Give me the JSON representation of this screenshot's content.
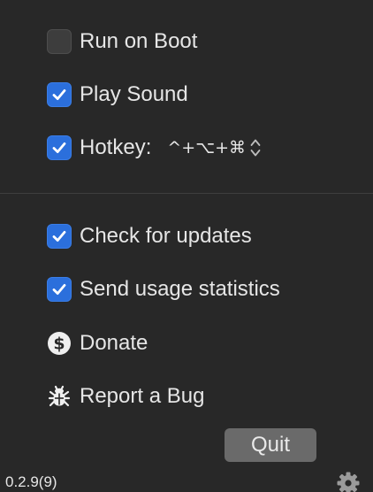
{
  "settings": {
    "run_on_boot": {
      "label": "Run on Boot",
      "checked": false
    },
    "play_sound": {
      "label": "Play Sound",
      "checked": true
    },
    "hotkey": {
      "label": "Hotkey:",
      "checked": true,
      "value": "^+⌥+⌘"
    }
  },
  "options": {
    "check_updates": {
      "label": "Check for updates",
      "checked": true
    },
    "send_stats": {
      "label": "Send usage statistics",
      "checked": true
    }
  },
  "actions": {
    "donate": {
      "label": "Donate",
      "icon": "dollar-circle-icon"
    },
    "report_bug": {
      "label": "Report a Bug",
      "icon": "bug-icon"
    }
  },
  "footer": {
    "quit_label": "Quit",
    "version": "0.2.9(9)",
    "settings_icon": "gear-icon"
  },
  "colors": {
    "background": "#282828",
    "checkbox_checked": "#2b6fdc",
    "checkbox_unchecked": "#3d3d3d",
    "quit_button": "#6a6a6a",
    "text": "#e6e6e6"
  }
}
